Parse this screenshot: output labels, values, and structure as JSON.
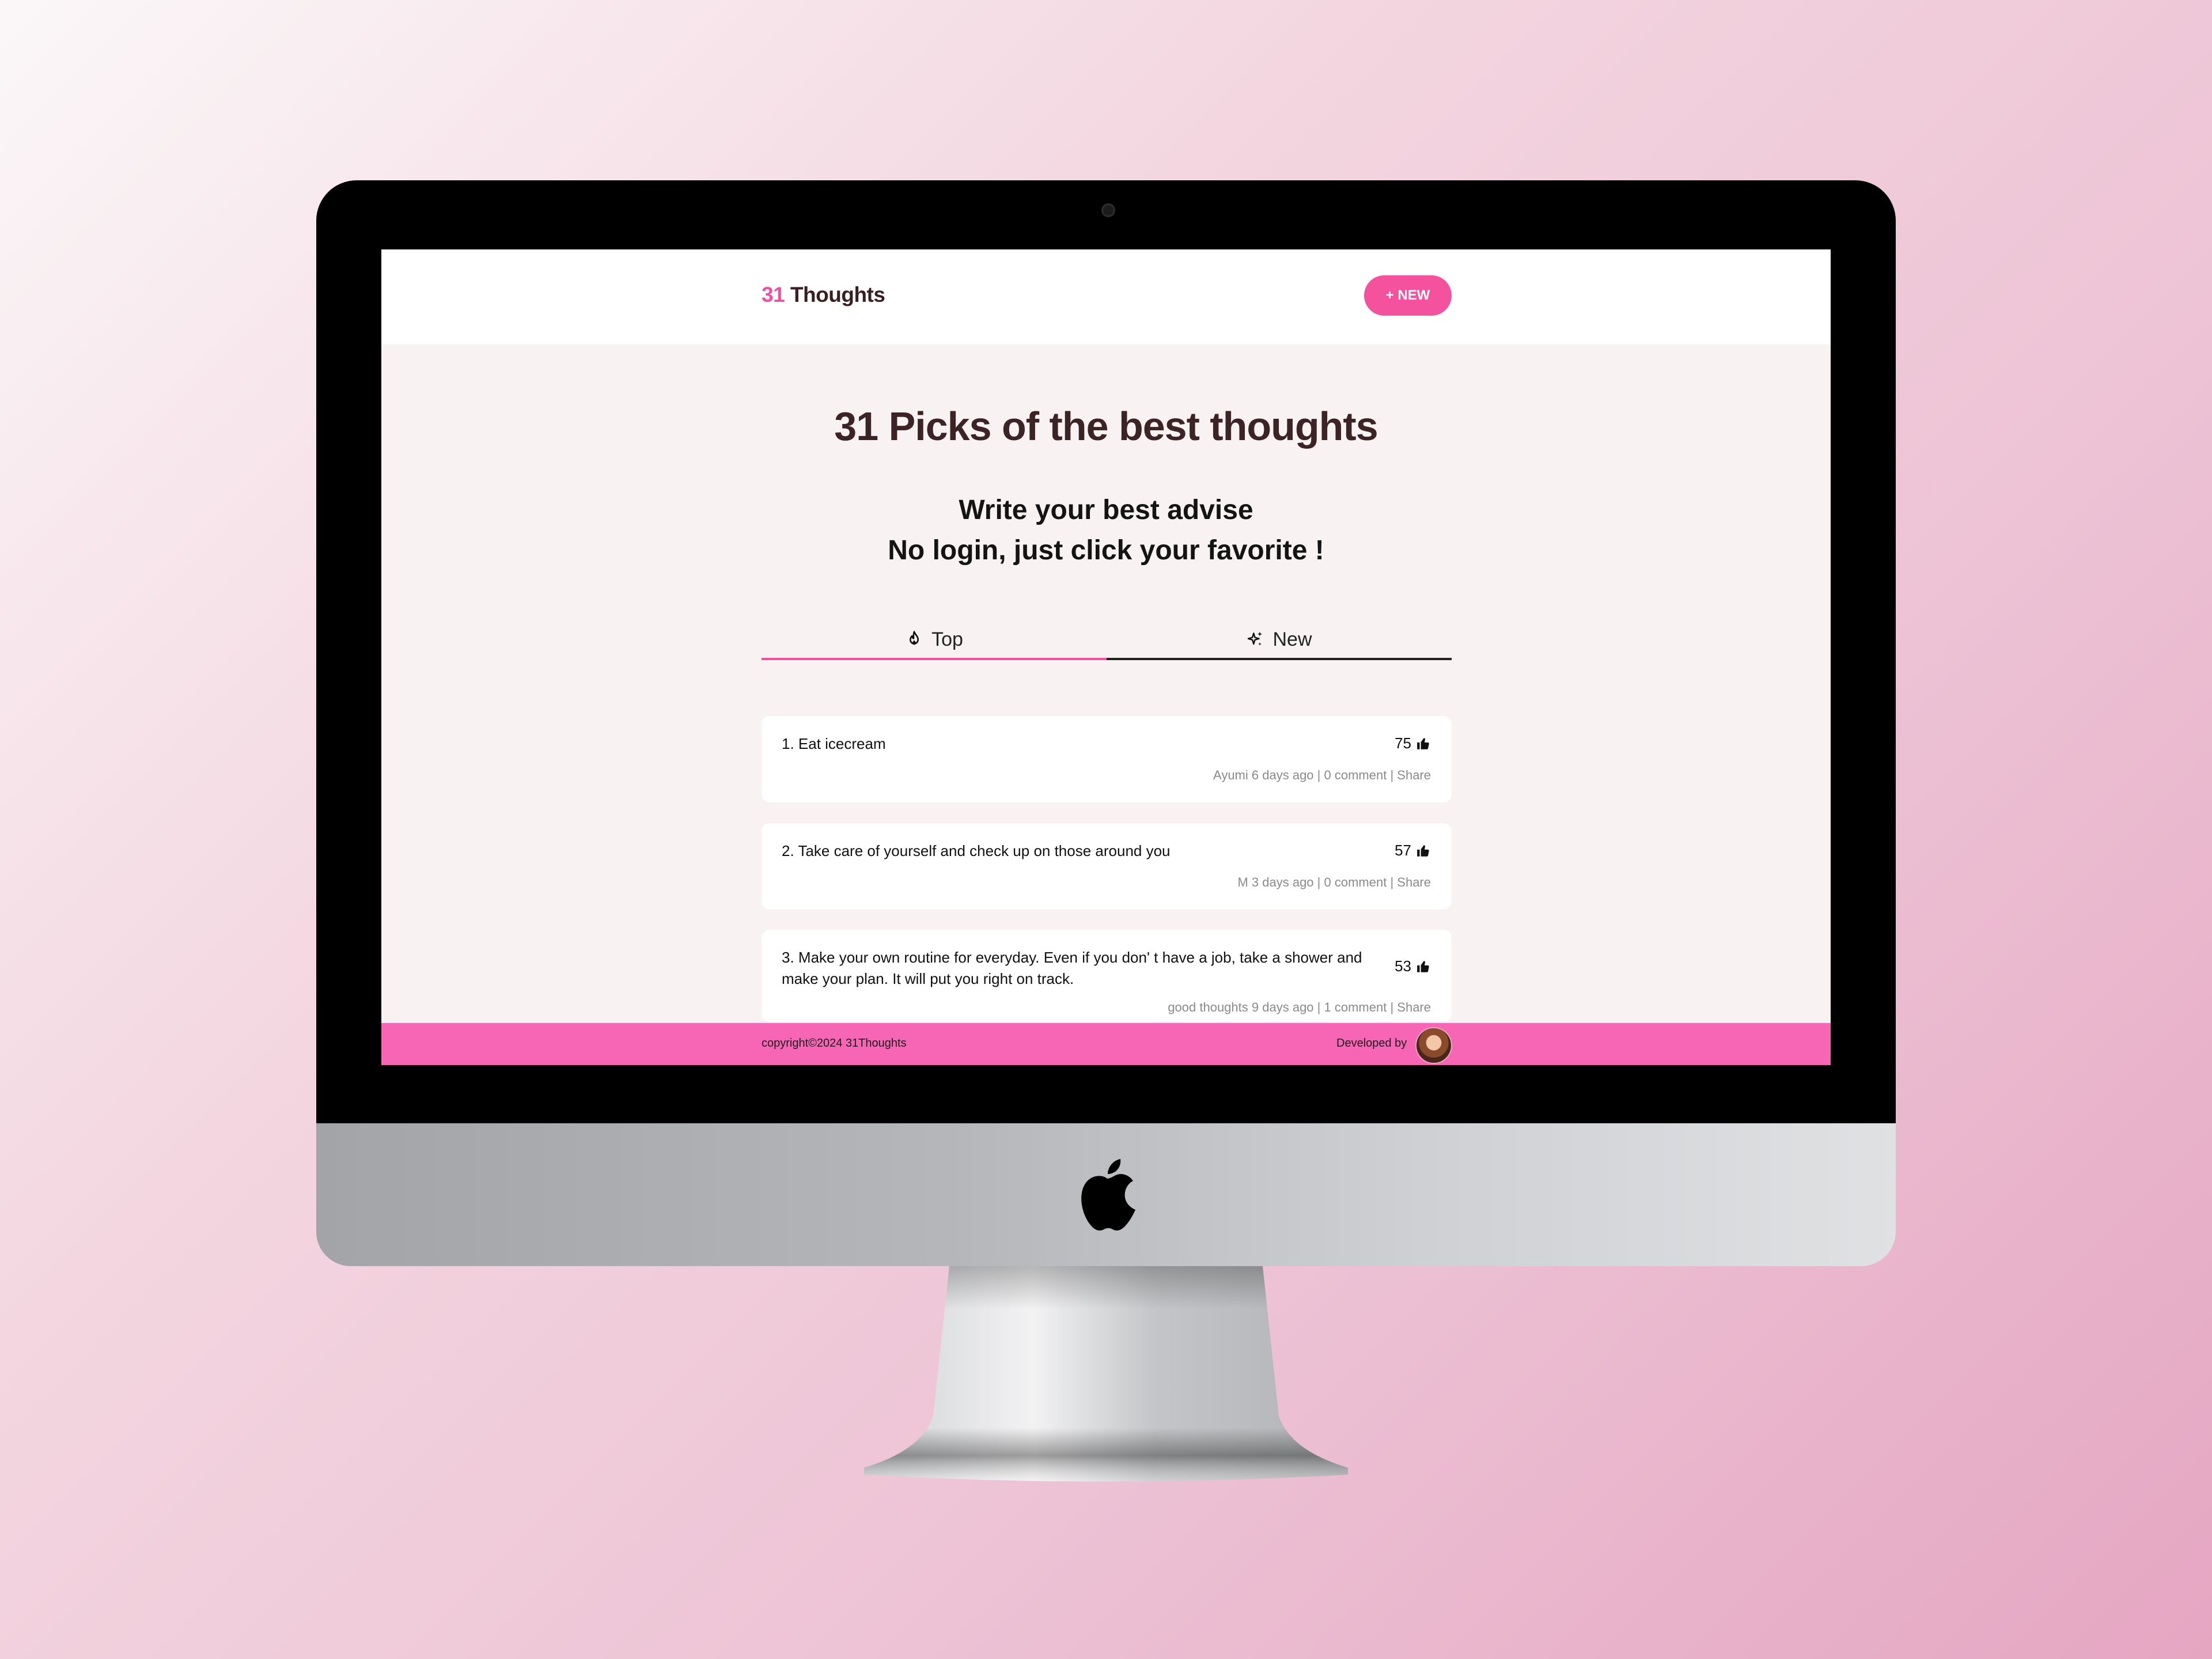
{
  "app": {
    "logo_number": "31",
    "logo_text": "Thoughts",
    "new_button": "+ NEW"
  },
  "hero": {
    "title": "31 Picks of the best thoughts",
    "subtitle_line1": "Write your best advise",
    "subtitle_line2": "No login, just click your favorite !"
  },
  "tabs": [
    {
      "label": "Top",
      "icon": "fire-icon",
      "active": true
    },
    {
      "label": "New",
      "icon": "sparkle-icon",
      "active": false
    }
  ],
  "thoughts": [
    {
      "text": "1. Eat icecream",
      "likes": "75",
      "author": "Ayumi",
      "time": "6 days ago",
      "comments": "0 comment",
      "share": "Share"
    },
    {
      "text": "2. Take care of yourself and check up on those around you",
      "likes": "57",
      "author": "M",
      "time": "3 days ago",
      "comments": "0 comment",
      "share": "Share"
    },
    {
      "text": "3. Make your own routine for everyday. Even if you don' t have a job, take a shower and make your plan. It will put you right on track.",
      "likes": "53",
      "author": "good thoughts",
      "time": "9 days ago",
      "comments": "1 comment",
      "share": "Share"
    }
  ],
  "footer": {
    "copyright": "copyright©2024 31Thoughts",
    "developed_by": "Developed by"
  },
  "colors": {
    "accent": "#f0509c",
    "footer": "#f765b5",
    "heading": "#3c2326"
  }
}
